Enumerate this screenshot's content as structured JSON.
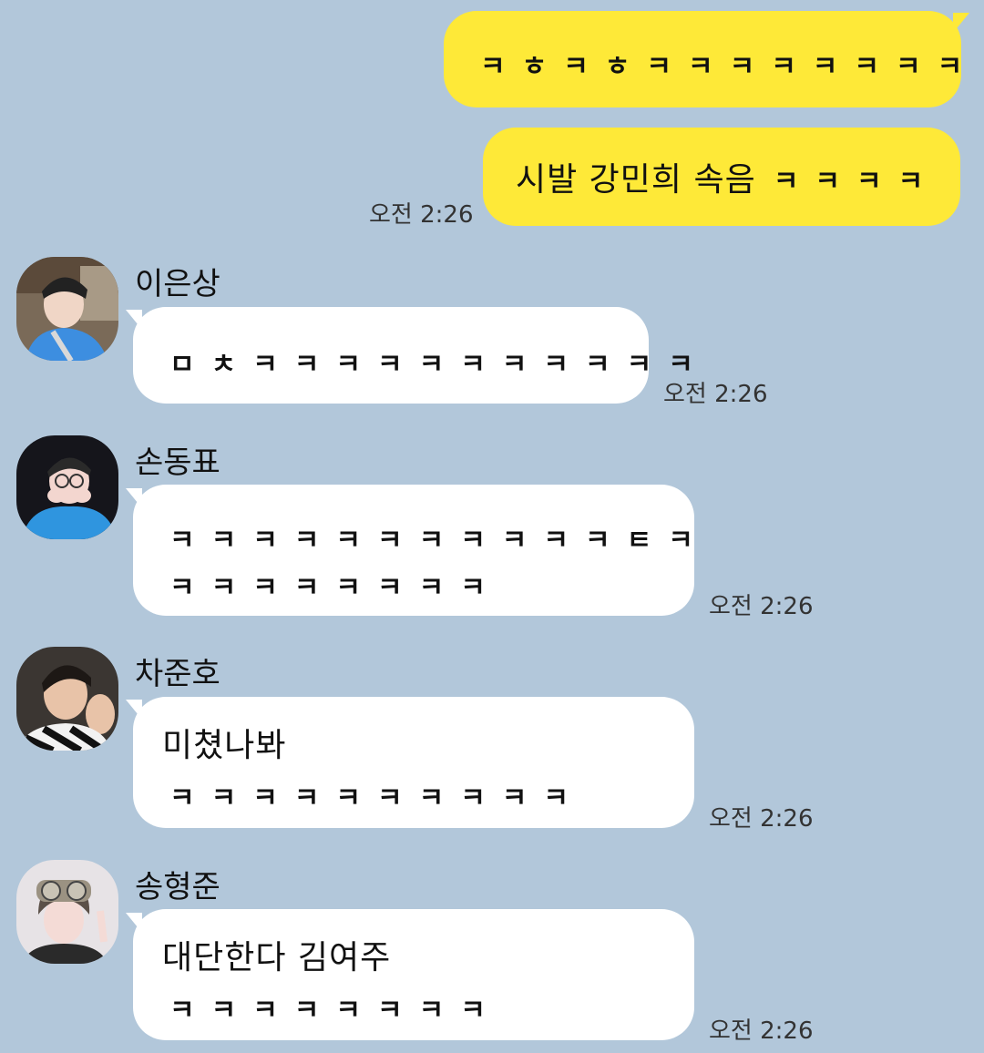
{
  "messages_out": [
    {
      "text": "ㅋㅎㅋㅎㅋㅋㅋㅋㅋㅋㅋㅋ"
    },
    {
      "text_main": "시발 강민희 속음",
      "text_tail": "ㅋㅋㅋㅋ",
      "time": "오전 2:26"
    }
  ],
  "messages_in": [
    {
      "sender": "이은상",
      "avatar": "profile-photo",
      "lines": [
        "ㅁㅊㅋㅋㅋㅋㅋㅋㅋㅋㅋㅋㅋ"
      ],
      "time": "오전 2:26"
    },
    {
      "sender": "손동표",
      "avatar": "profile-photo",
      "lines": [
        "ㅋㅋㅋㅋㅋㅋㅋㅋㅋㅋㅋㅌㅋ",
        "ㅋㅋㅋㅋㅋㅋㅋㅋ"
      ],
      "time": "오전 2:26"
    },
    {
      "sender": "차준호",
      "avatar": "profile-photo",
      "line1": "미쳤나봐",
      "line2": "ㅋㅋㅋㅋㅋㅋㅋㅋㅋㅋ",
      "time": "오전 2:26"
    },
    {
      "sender": "송형준",
      "avatar": "profile-photo",
      "line1": "대단한다 김여주",
      "line2": "ㅋㅋㅋㅋㅋㅋㅋㅋ",
      "time": "오전 2:26"
    }
  ],
  "colors": {
    "background": "#b2c7da",
    "bubble_out": "#fee938",
    "bubble_in": "#ffffff"
  }
}
